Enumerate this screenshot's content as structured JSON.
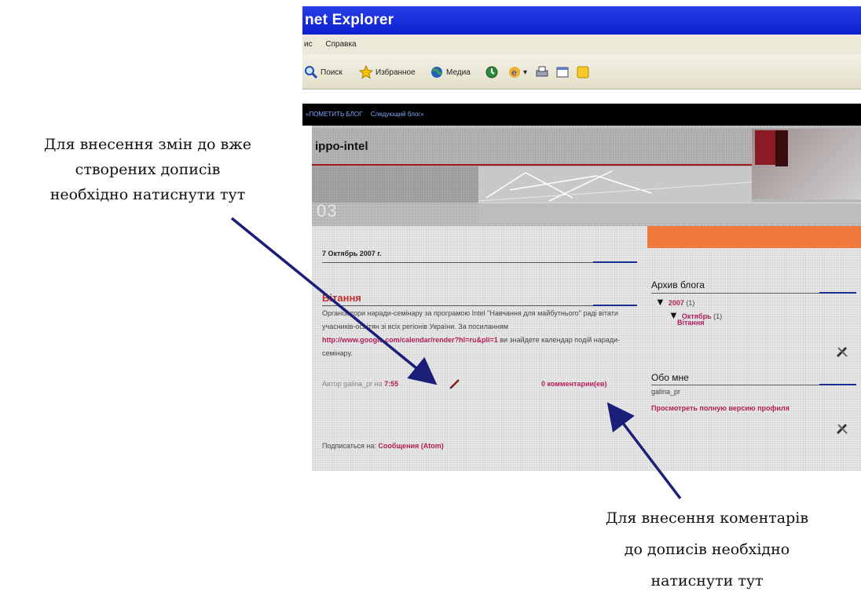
{
  "browser": {
    "title": "net Explorer",
    "menu": [
      "ис",
      "Справка"
    ],
    "toolbar": {
      "search": "Поиск",
      "favorites": "Избранное",
      "media": "Медиа"
    }
  },
  "navbar": {
    "flag_blog": "«ПОМЕТИТЬ БЛОГ",
    "next_blog": "Следующий блог»"
  },
  "blog": {
    "title": "ippo-intel",
    "header_number": "03"
  },
  "post": {
    "date": "7 Октябрь 2007 г.",
    "title": "Вітання",
    "body_1": "Організатори наради-семінару за програмою Intel \"Навчання для майбутнього\" раді вітати учасників-освітян зі всіх регіонів України. За посиланням ",
    "link": "http://www.google.com/calendar/render?hl=ru&pli=1",
    "body_2": " ви знайдете календар подій наради-семінару.",
    "author_prefix": "Автор galina_pr на",
    "time": "7:55",
    "comments": "0 комментарии(ев)",
    "subscribe_prefix": "Подписаться на:",
    "subscribe_link": "Сообщения (Atom)"
  },
  "sidebar": {
    "archive_title": "Архив блога",
    "year": "2007",
    "year_count": "(1)",
    "month": "Октябрь",
    "month_count": "(1)",
    "post": "Вітання",
    "about_title": "Обо мне",
    "user": "galina_pr",
    "profile_link": "Просмотреть полную версию профиля"
  },
  "annotations": {
    "edit_note": [
      "Для внесення змін до вже",
      "створених дописів",
      "необхідно натиснути тут"
    ],
    "comment_note": [
      "Для внесення коментарів",
      "до дописів необхідно",
      "натиснути тут"
    ]
  }
}
